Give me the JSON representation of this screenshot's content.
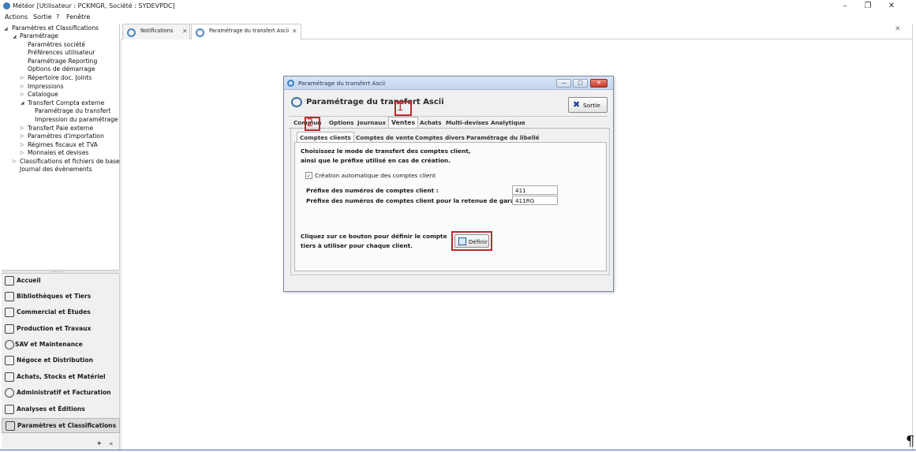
{
  "window": {
    "title": "Météor [Utilisateur : PCKMGR, Société : SYDEVPDC]",
    "minimize": "–",
    "restore": "❐",
    "close": "✕"
  },
  "menu": [
    "Actions",
    "Sortie",
    "?",
    "Fenêtre"
  ],
  "tree": [
    {
      "label": "Paramètres et Classifications",
      "arrow": "◢"
    },
    {
      "label": "Paramétrage",
      "arrow": "◢"
    },
    {
      "label": "Paramètres société",
      "arrow": ""
    },
    {
      "label": "Préférences utilisateur",
      "arrow": ""
    },
    {
      "label": "Paramétrage Reporting",
      "arrow": ""
    },
    {
      "label": "Options de démarrage",
      "arrow": ""
    },
    {
      "label": "Répertoire doc. Joints",
      "arrow": "▷"
    },
    {
      "label": "Impressions",
      "arrow": "▷"
    },
    {
      "label": "Catalogue",
      "arrow": "▷"
    },
    {
      "label": "Transfert Compta externe",
      "arrow": "◢"
    },
    {
      "label": "Paramétrage du transfert",
      "arrow": ""
    },
    {
      "label": "Impression du paramétrage",
      "arrow": ""
    },
    {
      "label": "Transfert Paie externe",
      "arrow": "▷"
    },
    {
      "label": "Paramètres d'importation",
      "arrow": "▷"
    },
    {
      "label": "Régimes fiscaux et TVA",
      "arrow": "▷"
    },
    {
      "label": "Monnaies et devises",
      "arrow": "▷"
    },
    {
      "label": "Classifications et fichiers de base",
      "arrow": "▷"
    },
    {
      "label": "Journal des évènements",
      "arrow": ""
    }
  ],
  "grip": "........",
  "nav": [
    {
      "label": "Accueil",
      "icon": "home-icon"
    },
    {
      "label": "Bibliothèques et Tiers",
      "icon": "library-icon"
    },
    {
      "label": "Commercial et Études",
      "icon": "commercial-icon"
    },
    {
      "label": "Production et Travaux",
      "icon": "production-icon"
    },
    {
      "label": "SAV et Maintenance",
      "icon": "gear-icon"
    },
    {
      "label": "Négoce et Distribution",
      "icon": "negoce-icon"
    },
    {
      "label": "Achats, Stocks et Matériel",
      "icon": "cart-icon"
    },
    {
      "label": "Administratif et Facturation",
      "icon": "admin-icon"
    },
    {
      "label": "Analyses et Éditions",
      "icon": "analysis-icon"
    },
    {
      "label": "Paramètres et Classifications",
      "icon": "settings-icon"
    }
  ],
  "nav_bottom": {
    "pin": "✦",
    "collapse": "«"
  },
  "doc_tabs": [
    {
      "label": "Notifications",
      "close": "✕"
    },
    {
      "label": "Paramétrage du transfert Ascii",
      "close": "✕"
    }
  ],
  "tabstrip_close": "✕",
  "dialog": {
    "title": "Paramétrage du transfert Ascii",
    "header": "Paramétrage du transfert Ascii",
    "sortie_label": "Sortie",
    "sortie_icon": "✖",
    "main_tabs": [
      "Commun",
      "Options",
      "Journaux",
      "Ventes",
      "Achats",
      "Multi-devises",
      "Analytique"
    ],
    "active_main_tab": "Ventes",
    "sub_tabs": [
      "Comptes clients",
      "Comptes de vente",
      "Comptes divers",
      "Paramétrage du libellé"
    ],
    "active_sub_tab": "Comptes clients",
    "intro_line1": "Choisissez le mode de transfert des comptes client,",
    "intro_line2": "ainsi que le préfixe utilisé en cas de création.",
    "auto_create_label": "Création automatique des comptes client",
    "auto_create_checked": true,
    "prefix_label": "Préfixe des numéros de comptes client :",
    "prefix_value": "411",
    "prefix_retenue_label": "Préfixe des numéros de comptes client pour la retenue de garar",
    "prefix_retenue_value": "411RG",
    "define_line1": "Cliquez sur ce bouton pour définir le compte",
    "define_line2": "tiers à utiliser pour chaque client.",
    "definir_label": "Définir"
  },
  "markers": {
    "one": "1",
    "two": "2"
  },
  "pilcrow": "¶",
  "colors": {
    "accent": "#3b7dbf",
    "highlight": "#c0272d",
    "nav_bg": "#f0f0f0",
    "dialog_bg": "#f0f0f0"
  }
}
